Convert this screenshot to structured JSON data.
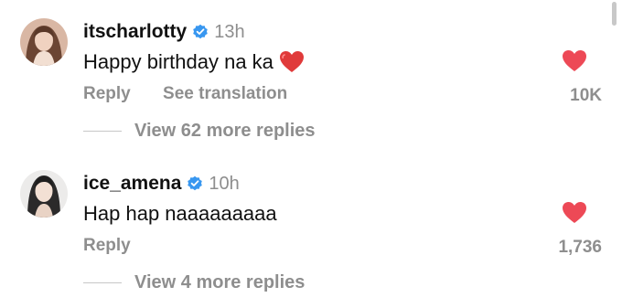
{
  "comments": [
    {
      "username": "itscharlotty",
      "verified": true,
      "time": "13h",
      "text": "Happy birthday na ka",
      "emoji": "red-heart",
      "actions": [
        "Reply",
        "See translation"
      ],
      "likes": "10K",
      "view_more": "View 62 more replies"
    },
    {
      "username": "ice_amena",
      "verified": true,
      "time": "10h",
      "text": "Hap hap naaaaaaaaa",
      "actions": [
        "Reply"
      ],
      "likes": "1,736",
      "view_more": "View 4 more replies"
    }
  ],
  "colors": {
    "like_heart": "#ed4956",
    "verified_badge": "#3897f0",
    "muted_text": "#8e8e8e"
  }
}
